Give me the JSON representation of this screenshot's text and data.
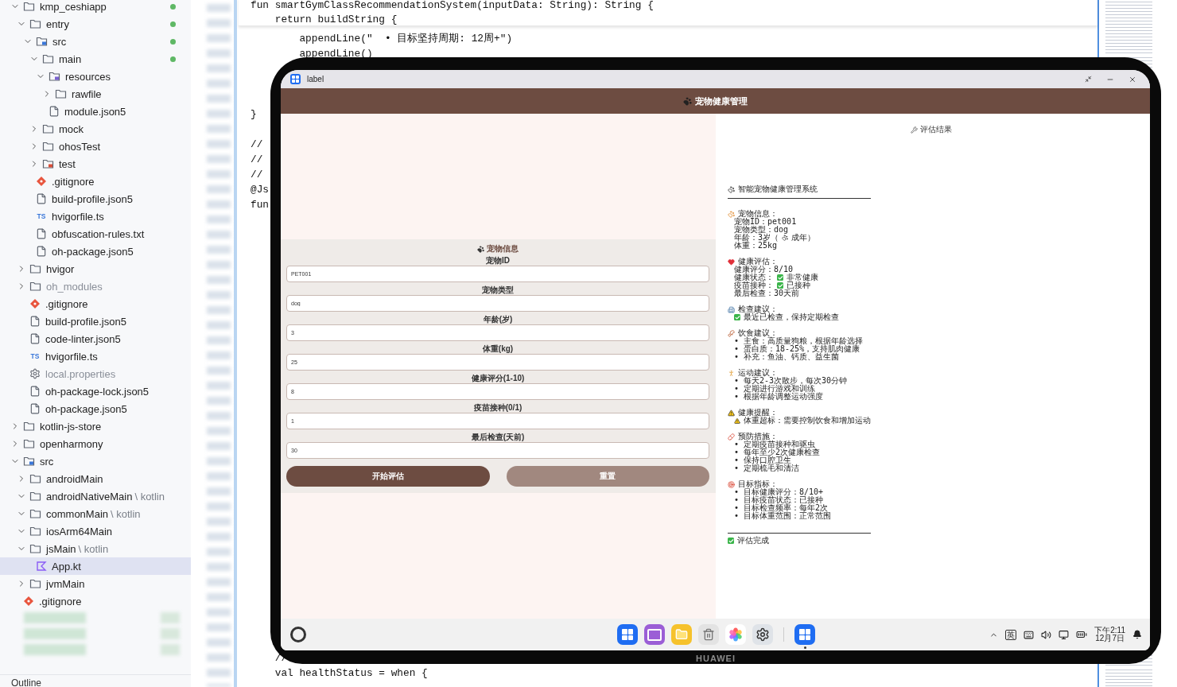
{
  "tree": {
    "items": [
      {
        "label": "kmp_ceshiapp",
        "kind": "folder",
        "expanded": true,
        "modified": true,
        "dimmed": false,
        "selected": false,
        "children": [
          {
            "label": "entry",
            "kind": "folder",
            "expanded": true,
            "modified": true,
            "dimmed": false,
            "selected": false,
            "children": [
              {
                "label": "src",
                "kind": "source-folder",
                "expanded": true,
                "modified": true,
                "dimmed": false,
                "selected": false,
                "children": [
                  {
                    "label": "main",
                    "kind": "folder",
                    "expanded": true,
                    "modified": true,
                    "dimmed": false,
                    "selected": false,
                    "children": [
                      {
                        "label": "resources",
                        "kind": "resource-folder",
                        "expanded": true,
                        "modified": false,
                        "dimmed": false,
                        "selected": false,
                        "children": [
                          {
                            "label": "rawfile",
                            "kind": "folder",
                            "expanded": false,
                            "modified": false,
                            "dimmed": false,
                            "selected": false
                          }
                        ]
                      },
                      {
                        "label": "module.json5",
                        "kind": "file",
                        "modified": false,
                        "dimmed": false,
                        "selected": false
                      }
                    ]
                  },
                  {
                    "label": "mock",
                    "kind": "folder",
                    "expanded": false,
                    "modified": false,
                    "dimmed": false,
                    "selected": false
                  },
                  {
                    "label": "ohosTest",
                    "kind": "folder",
                    "expanded": false,
                    "modified": false,
                    "dimmed": false,
                    "selected": false
                  },
                  {
                    "label": "test",
                    "kind": "test-folder",
                    "expanded": false,
                    "modified": false,
                    "dimmed": false,
                    "selected": false
                  }
                ]
              },
              {
                "label": ".gitignore",
                "kind": "git",
                "modified": false,
                "dimmed": false,
                "selected": false
              },
              {
                "label": "build-profile.json5",
                "kind": "file",
                "modified": false,
                "dimmed": false,
                "selected": false
              },
              {
                "label": "hvigorfile.ts",
                "kind": "ts",
                "badge": "TS",
                "modified": false,
                "dimmed": false,
                "selected": false
              },
              {
                "label": "obfuscation-rules.txt",
                "kind": "file",
                "modified": false,
                "dimmed": false,
                "selected": false
              },
              {
                "label": "oh-package.json5",
                "kind": "file",
                "modified": false,
                "dimmed": false,
                "selected": false
              }
            ]
          },
          {
            "label": "hvigor",
            "kind": "folder",
            "expanded": false,
            "modified": false,
            "dimmed": false,
            "selected": false
          },
          {
            "label": "oh_modules",
            "kind": "folder",
            "expanded": false,
            "modified": false,
            "dimmed": true,
            "selected": false
          },
          {
            "label": ".gitignore",
            "kind": "git",
            "modified": false,
            "dimmed": false,
            "selected": false
          },
          {
            "label": "build-profile.json5",
            "kind": "file",
            "modified": false,
            "dimmed": false,
            "selected": false
          },
          {
            "label": "code-linter.json5",
            "kind": "file",
            "modified": false,
            "dimmed": false,
            "selected": false
          },
          {
            "label": "hvigorfile.ts",
            "kind": "ts",
            "badge": "TS",
            "modified": false,
            "dimmed": false,
            "selected": false
          },
          {
            "label": "local.properties",
            "kind": "gear",
            "modified": false,
            "dimmed": true,
            "selected": false
          },
          {
            "label": "oh-package-lock.json5",
            "kind": "file",
            "modified": false,
            "dimmed": false,
            "selected": false
          },
          {
            "label": "oh-package.json5",
            "kind": "file",
            "modified": false,
            "dimmed": false,
            "selected": false
          }
        ]
      },
      {
        "label": "kotlin-js-store",
        "kind": "folder",
        "expanded": false,
        "modified": false,
        "dimmed": false,
        "selected": false
      },
      {
        "label": "openharmony",
        "kind": "folder",
        "expanded": false,
        "modified": false,
        "dimmed": false,
        "selected": false
      },
      {
        "label": "src",
        "kind": "source-folder",
        "expanded": true,
        "modified": false,
        "dimmed": false,
        "selected": false,
        "children": [
          {
            "label": "androidMain",
            "kind": "folder",
            "expanded": false,
            "modified": false,
            "dimmed": false,
            "selected": false
          },
          {
            "label": "androidNativeMain",
            "suffix": "\\ kotlin",
            "kind": "folder",
            "expanded": true,
            "modified": false,
            "dimmed": false,
            "selected": false
          },
          {
            "label": "commonMain",
            "suffix": "\\ kotlin",
            "kind": "folder",
            "expanded": true,
            "modified": false,
            "dimmed": false,
            "selected": false
          },
          {
            "label": "iosArm64Main",
            "kind": "folder",
            "expanded": true,
            "modified": false,
            "dimmed": false,
            "selected": false
          },
          {
            "label": "jsMain",
            "suffix": "\\ kotlin",
            "kind": "folder",
            "expanded": true,
            "modified": false,
            "dimmed": false,
            "selected": false,
            "children": [
              {
                "label": "App.kt",
                "kind": "kotlin",
                "modified": false,
                "dimmed": false,
                "selected": true
              }
            ]
          },
          {
            "label": "jvmMain",
            "kind": "folder",
            "expanded": false,
            "modified": false,
            "dimmed": false,
            "selected": false
          }
        ]
      },
      {
        "label": ".gitignore",
        "kind": "git",
        "modified": false,
        "dimmed": false,
        "selected": false
      }
    ],
    "footer": "Outline"
  },
  "code": {
    "sticky": [
      "fun smartGymClassRecommendationSystem(inputData: String): String {",
      "    return buildString {"
    ],
    "blocks": [
      [
        "        appendLine(\"  • 目标坚持周期: 12周+\")",
        "        appendLine()"
      ],
      [
        "}"
      ],
      [
        "// ",
        "// ",
        "// ",
        "@Js",
        "fun"
      ],
      [
        "    //",
        "    val healthStatus = when {"
      ]
    ]
  },
  "device": {
    "brand": "HUAWEI",
    "window": {
      "title": "label"
    },
    "app": {
      "title": "宠物健康管理",
      "form": {
        "title": "宠物信息",
        "fields": [
          {
            "label": "宠物ID",
            "value": "PET001"
          },
          {
            "label": "宠物类型",
            "value": "dog"
          },
          {
            "label": "年龄(岁)",
            "value": "3"
          },
          {
            "label": "体重(kg)",
            "value": "25"
          },
          {
            "label": "健康评分(1-10)",
            "value": "8"
          },
          {
            "label": "疫苗接种(0/1)",
            "value": "1"
          },
          {
            "label": "最后检查(天前)",
            "value": "30"
          }
        ],
        "buttons": [
          {
            "label": "开始评估",
            "kind": "primary"
          },
          {
            "label": "重置",
            "kind": "secondary"
          }
        ]
      },
      "result": {
        "title": "评估结果",
        "report_title": "智能宠物健康管理系统",
        "sections": [
          {
            "kind": "pet",
            "heading": "宠物信息：",
            "lines": [
              {
                "kind": "text",
                "text": "宠物ID：pet001"
              },
              {
                "kind": "text",
                "text": "宠物类型：dog"
              },
              {
                "kind": "paw-inline",
                "text": "年龄：3岁（",
                "after": "成年）"
              },
              {
                "kind": "text",
                "text": "体重：25kg"
              }
            ]
          },
          {
            "kind": "health",
            "heading": "健康评估：",
            "lines": [
              {
                "kind": "text",
                "text": "健康评分：8/10"
              },
              {
                "kind": "check-inline",
                "text": "健康状态：",
                "after": "非常健康"
              },
              {
                "kind": "check-inline",
                "text": "疫苗接种：",
                "after": "已接种"
              },
              {
                "kind": "text",
                "text": "最后检查：30天前"
              }
            ]
          },
          {
            "kind": "clinic",
            "heading": "检查建议：",
            "lines": [
              {
                "kind": "check-lead",
                "text": "最近已检查，保持定期检查"
              }
            ]
          },
          {
            "kind": "diet",
            "heading": "饮食建议：",
            "lines": [
              {
                "kind": "text",
                "text": "• 主食：高质量狗粮，根据年龄选择"
              },
              {
                "kind": "text",
                "text": "• 蛋白质：18-25%，支持肌肉健康"
              },
              {
                "kind": "text",
                "text": "• 补充：鱼油、钙质、益生菌"
              }
            ]
          },
          {
            "kind": "exercise",
            "heading": "运动建议：",
            "lines": [
              {
                "kind": "text",
                "text": "• 每天2-3次散步，每次30分钟"
              },
              {
                "kind": "text",
                "text": "• 定期进行游戏和训练"
              },
              {
                "kind": "text",
                "text": "• 根据年龄调整运动强度"
              }
            ]
          },
          {
            "kind": "alert",
            "heading": "健康提醒：",
            "lines": [
              {
                "kind": "warn-lead",
                "text": "体重超标：需要控制饮食和增加运动"
              }
            ]
          },
          {
            "kind": "prevention",
            "heading": "预防措施：",
            "lines": [
              {
                "kind": "text",
                "text": "• 定期疫苗接种和驱虫"
              },
              {
                "kind": "text",
                "text": "• 每年至少2次健康检查"
              },
              {
                "kind": "text",
                "text": "• 保持口腔卫生"
              },
              {
                "kind": "text",
                "text": "• 定期梳毛和清洁"
              }
            ]
          },
          {
            "kind": "goal",
            "heading": "目标指标：",
            "lines": [
              {
                "kind": "text",
                "text": "• 目标健康评分：8/10+"
              },
              {
                "kind": "text",
                "text": "• 目标疫苗状态：已接种"
              },
              {
                "kind": "text",
                "text": "• 目标检查频率：每年2次"
              },
              {
                "kind": "text",
                "text": "• 目标体重范围：正常范围"
              }
            ]
          }
        ],
        "footer": "评估完成"
      }
    },
    "taskbar": {
      "ime": "英",
      "time": "下午2:11",
      "date": "12月7日"
    }
  }
}
